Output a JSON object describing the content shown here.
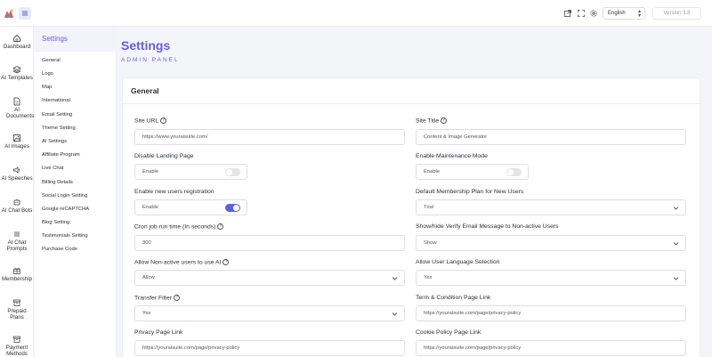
{
  "topbar": {
    "language": "English",
    "version": "Version 3.8"
  },
  "nav": [
    {
      "label": "Dashboard",
      "icon": "home-icon"
    },
    {
      "label": "AI Templates",
      "icon": "layers-icon"
    },
    {
      "label": "AI Documents",
      "icon": "document-icon"
    },
    {
      "label": "AI Images",
      "icon": "image-icon"
    },
    {
      "label": "AI Speeches",
      "icon": "speaker-icon"
    },
    {
      "label": "AI Chat Bots",
      "icon": "robot-icon"
    },
    {
      "label": "AI Chat Prompts",
      "icon": "list-icon"
    },
    {
      "label": "Membership",
      "icon": "gift-icon"
    },
    {
      "label": "Prepaid Plans",
      "icon": "box-icon"
    },
    {
      "label": "Payment Methods",
      "icon": "archive-icon"
    }
  ],
  "submenu": {
    "title": "Settings",
    "items": [
      "General",
      "Logo",
      "Map",
      "International",
      "Email Setting",
      "Theme Setting",
      "AI Settings",
      "Affiliate Program",
      "Live Chat",
      "Billing Details",
      "Social Login Setting",
      "Google reCAPTCHA",
      "Blog Setting",
      "Testimonials Setting",
      "Purchase Code"
    ]
  },
  "page": {
    "title": "Settings",
    "subtitle": "ADMIN PANEL"
  },
  "card": {
    "title": "General",
    "fields": {
      "site_url": {
        "label": "Site URL",
        "value": "https://www.youraisuite.com/"
      },
      "site_title": {
        "label": "Site Title",
        "value": "Content & Image Generator"
      },
      "disable_landing": {
        "label": "Disable Landing Page",
        "value": "Enable",
        "on": false
      },
      "maintenance": {
        "label": "Enable Maintenance Mode",
        "value": "Enable",
        "on": false
      },
      "registration": {
        "label": "Enable new users registration",
        "value": "Enable",
        "on": true
      },
      "default_plan": {
        "label": "Default Membership Plan for New Users",
        "value": "Trial"
      },
      "cron": {
        "label": "Cron job run time (In seconds)",
        "value": "300"
      },
      "verify_email": {
        "label": "Show/hide Verify Email Message to Non-active Users",
        "value": "Show"
      },
      "nonactive_ai": {
        "label": "Allow Non-active users to use AI",
        "value": "Allow"
      },
      "user_language": {
        "label": "Allow User Language Selection",
        "value": "Yes"
      },
      "transfer_filter": {
        "label": "Transfer Filter",
        "value": "Yes"
      },
      "terms_link": {
        "label": "Term & Condition Page Link",
        "value": "https://youraisuite.com/page/privacy-policy"
      },
      "privacy_link": {
        "label": "Privacy Page Link",
        "value": "https://youraisuite.com/page/privacy-policy"
      },
      "cookie_link": {
        "label": "Cookie Policy Page Link",
        "value": "https://youraisuite.com/page/privacy-policy"
      }
    }
  },
  "colors": {
    "accent": "#6a5fd8",
    "toggle_on": "#5b62e0"
  }
}
